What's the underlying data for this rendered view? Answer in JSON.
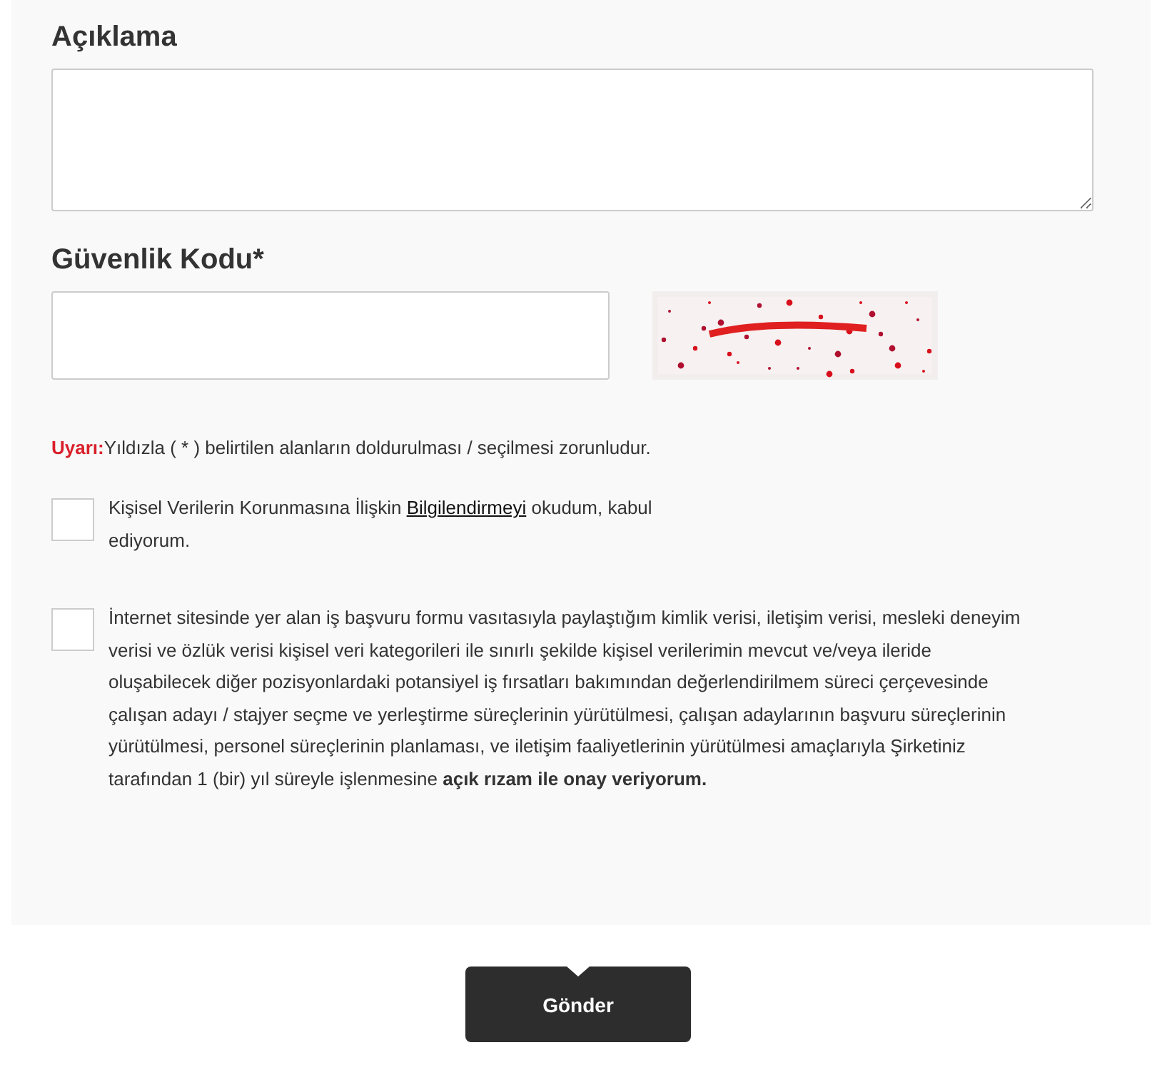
{
  "fields": [
    {
      "kind": "textarea",
      "label": "Açıklama"
    },
    {
      "kind": "captcha",
      "label": "Güvenlik Kodu*"
    }
  ],
  "warning": {
    "label": "Uyarı:",
    "text": "Yıldızla ( * ) belirtilen alanların doldurulması / seçilmesi zorunludur."
  },
  "consents": [
    {
      "checked": false,
      "text_before": "Kişisel Verilerin Korunmasına İlişkin ",
      "link": "Bilgilendirmeyi",
      "text_after": " okudum, kabul ediyorum."
    },
    {
      "checked": false,
      "text_before": "İnternet sitesinde yer alan iş başvuru formu vasıtasıyla paylaştığım kimlik verisi, iletişim verisi, mesleki deneyim verisi ve özlük verisi kişisel veri kategorileri ile sınırlı şekilde kişisel verilerimin mevcut ve/veya ileride oluşabilecek diğer pozisyonlardaki potansiyel iş fırsatları bakımından değerlendirilmem süreci çerçevesinde çalışan adayı / stajyer seçme ve yerleştirme süreçlerinin yürütülmesi, çalışan adaylarının başvuru süreçlerinin yürütülmesi, personel süreçlerinin planlaması, ve iletişim faaliyetlerinin yürütülmesi amaçlarıyla Şirketiniz tarafından 1 (bir) yıl süreyle işlenmesine **açık rızam ile onay veriyorum.**"
    }
  ],
  "submit": "Gönder"
}
